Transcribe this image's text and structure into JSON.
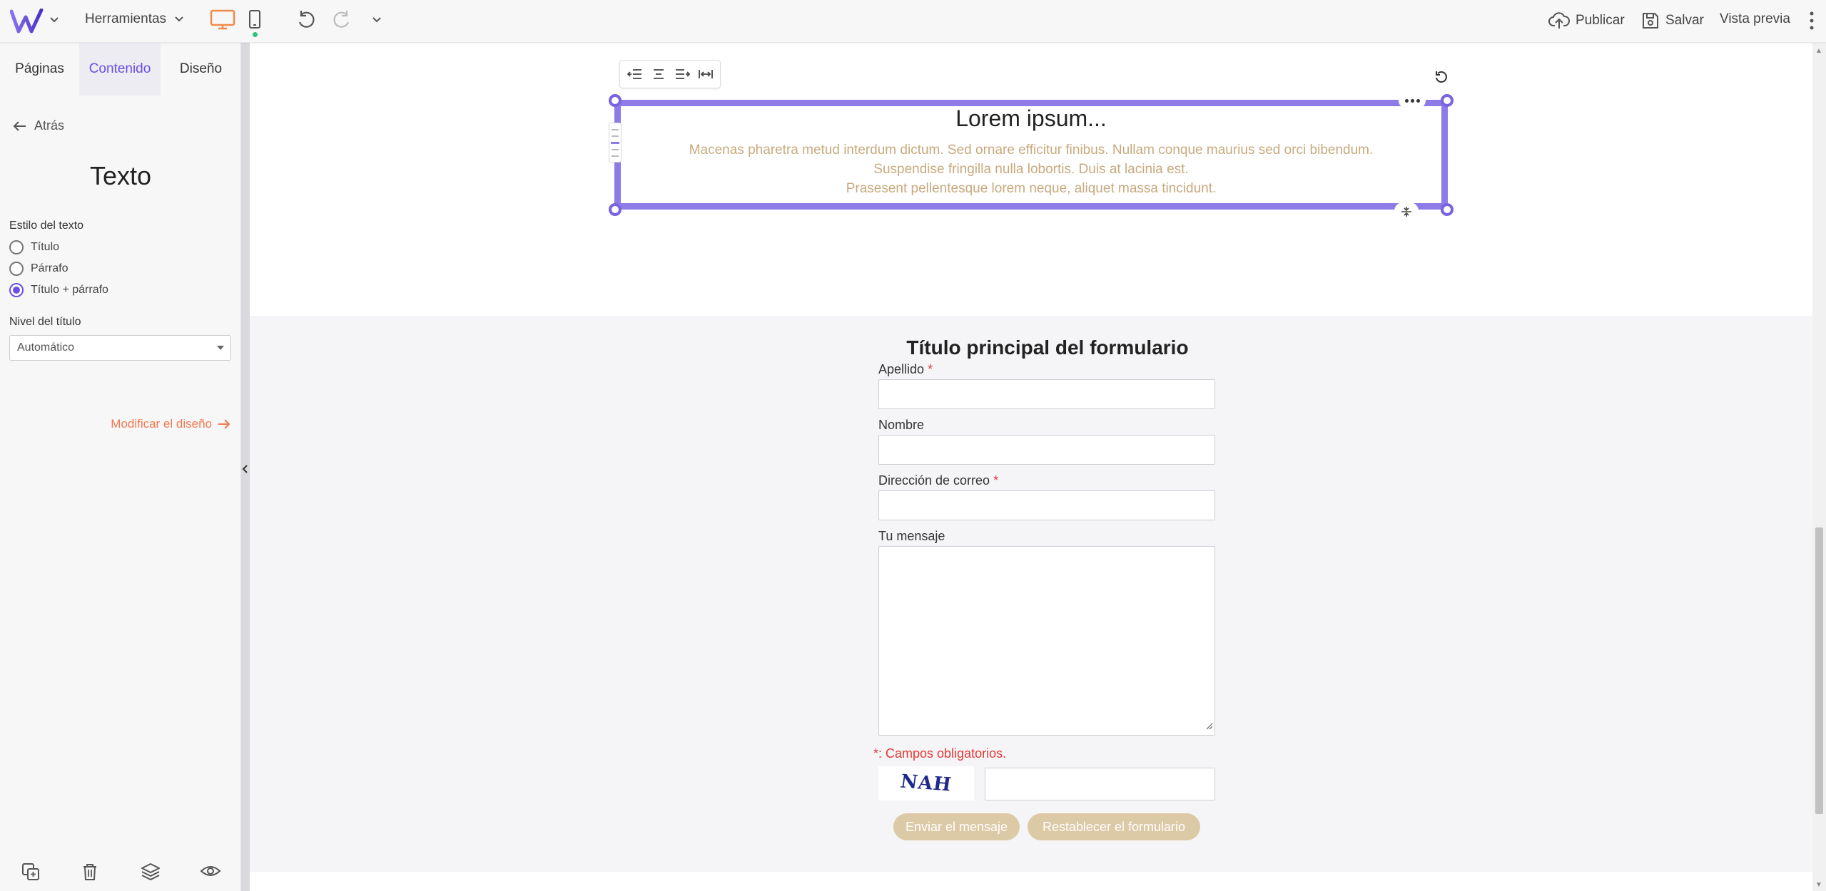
{
  "topbar": {
    "tools_label": "Herramientas",
    "publish_label": "Publicar",
    "save_label": "Salvar",
    "preview_label": "Vista previa"
  },
  "sidebar": {
    "tabs": [
      {
        "label": "Páginas"
      },
      {
        "label": "Contenido"
      },
      {
        "label": "Diseño"
      }
    ],
    "back_label": "Atrás",
    "panel_title": "Texto",
    "text_style_label": "Estilo del texto",
    "text_style_options": [
      {
        "label": "Título",
        "selected": false
      },
      {
        "label": "Párrafo",
        "selected": false
      },
      {
        "label": "Título + párrafo",
        "selected": true
      }
    ],
    "title_level_label": "Nivel del título",
    "title_level_value": "Automático",
    "modify_design_label": "Modificar el diseño"
  },
  "text_block": {
    "title": "Lorem ipsum...",
    "lines": [
      "Macenas pharetra metud interdum dictum. Sed ornare efficitur finibus. Nullam conque maurius sed orci bibendum.",
      "Suspendise fringilla nulla lobortis. Duis at lacinia est.",
      "Prasesent pellentesque lorem neque, aliquet massa tincidunt."
    ]
  },
  "form": {
    "title": "Título principal del formulario",
    "fields": [
      {
        "label": "Apellido",
        "required": "*"
      },
      {
        "label": "Nombre",
        "required": ""
      },
      {
        "label": "Dirección de correo",
        "required": "*"
      },
      {
        "label": "Tu mensaje",
        "required": ""
      }
    ],
    "required_note": "*: Campos obligatorios.",
    "captcha_text": "NAH",
    "send_label": "Enviar el mensaje",
    "reset_label": "Restablecer el formulario"
  },
  "colors": {
    "accent": "#6b4ee6",
    "selection": "#8f7be8",
    "link_orange": "#f07850",
    "paragraph_gold": "#c8a97e",
    "button_beige": "#dcc9a6",
    "required_red": "#e53935",
    "device_active": "#f08a4b",
    "status_green": "#2ec27e"
  },
  "icons": {
    "logo": "w-logo-icon",
    "desktop": "desktop-icon",
    "mobile": "mobile-icon",
    "undo": "undo-icon",
    "redo": "redo-icon",
    "publish": "cloud-upload-icon",
    "save": "floppy-disk-icon",
    "menu": "kebab-menu-icon"
  }
}
